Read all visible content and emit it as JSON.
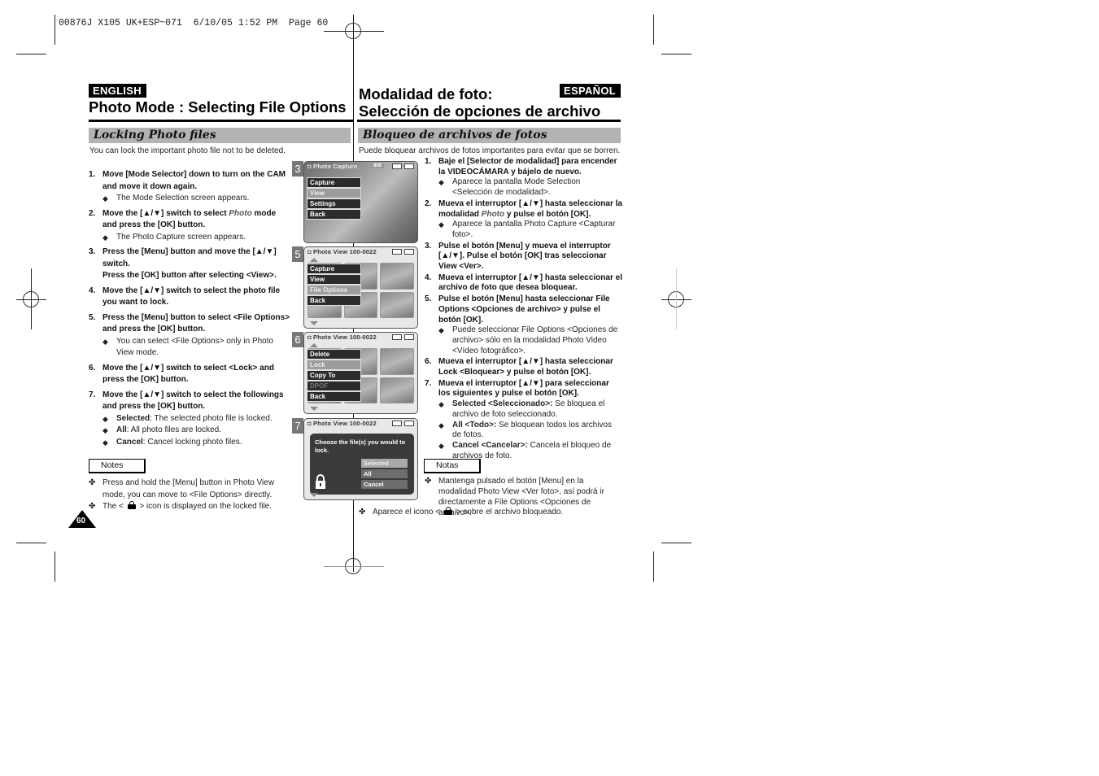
{
  "print_header": "00876J X105 UK+ESP~071  6/10/05 1:52 PM  Page 60",
  "page_number": "60",
  "english": {
    "lang_badge": "ENGLISH",
    "title": "Photo Mode : Selecting File Options",
    "section_title": "Locking Photo files",
    "intro": "You can lock the important photo file not to be deleted.",
    "steps": [
      {
        "num": "1.",
        "text": "Move [Mode Selector] down to turn on the CAM and move it down again.",
        "subs": [
          "The Mode Selection screen appears."
        ]
      },
      {
        "num": "2.",
        "text_before": "Move the [▲/▼] switch to select ",
        "text_em": "Photo",
        "text_after": " mode and press the [OK] button.",
        "subs": [
          "The Photo Capture screen appears."
        ]
      },
      {
        "num": "3.",
        "text": "Press the [Menu] button and move the [▲/▼] switch.",
        "text2": "Press the [OK] button after selecting <View>."
      },
      {
        "num": "4.",
        "text": "Move the [▲/▼] switch to select the photo file you want to lock."
      },
      {
        "num": "5.",
        "text": "Press the [Menu] button to select <File Options> and press the [OK] button.",
        "subs": [
          "You can select <File Options> only in Photo View mode."
        ]
      },
      {
        "num": "6.",
        "text": "Move the [▲/▼] switch to select <Lock> and press the [OK] button."
      },
      {
        "num": "7.",
        "text": "Move the [▲/▼] switch to select the followings and press the [OK] button.",
        "options": [
          {
            "term": "Selected",
            "desc": ": The selected photo file is locked."
          },
          {
            "term": "All",
            "desc": ": All photo files are locked."
          },
          {
            "term": "Cancel",
            "desc": ": Cancel locking photo files."
          }
        ]
      }
    ],
    "notes_label": "Notes",
    "notes": [
      "Press and hold the [Menu] button in Photo View mode, you can move to <File Options> directly."
    ],
    "note_lock_before": "The <",
    "note_lock_after": "> icon is displayed on the locked file."
  },
  "spanish": {
    "lang_badge": "ESPAÑOL",
    "title_line1": "Modalidad de foto:",
    "title_line2": "Selección de opciones de archivo",
    "section_title": "Bloqueo de archivos de fotos",
    "intro": "Puede bloquear archivos de fotos importantes para evitar que se borren.",
    "steps": [
      {
        "num": "1.",
        "text": "Baje el [Selector de modalidad] para encender la VIDEOCÁMARA y bájelo de nuevo.",
        "subs": [
          "Aparece la pantalla Mode Selection <Selección de modalidad>."
        ]
      },
      {
        "num": "2.",
        "text_before": "Mueva el interruptor [▲/▼] hasta seleccionar la modalidad ",
        "text_em": "Photo",
        "text_after": " y pulse el botón [OK].",
        "subs": [
          "Aparece la pantalla Photo Capture <Capturar foto>."
        ]
      },
      {
        "num": "3.",
        "text": "Pulse el botón [Menu] y mueva el interruptor [▲/▼]. Pulse el botón [OK] tras seleccionar View <Ver>."
      },
      {
        "num": "4.",
        "text": "Mueva el interruptor [▲/▼] hasta seleccionar el archivo de foto que desea bloquear."
      },
      {
        "num": "5.",
        "text": "Pulse el botón [Menu] hasta seleccionar File Options <Opciones de archivo> y pulse el botón [OK].",
        "subs": [
          "Puede seleccionar File Options <Opciones de archivo> sólo en la modalidad Photo Video <Vídeo fotográfico>."
        ]
      },
      {
        "num": "6.",
        "text": "Mueva el interruptor [▲/▼] hasta seleccionar Lock <Bloquear> y pulse el botón [OK]."
      },
      {
        "num": "7.",
        "text": "Mueva el interruptor [▲/▼] para seleccionar los siguientes y pulse el botón [OK].",
        "options": [
          {
            "term": "Selected <Seleccionado>:",
            "desc": " Se bloquea el archivo de foto seleccionado."
          },
          {
            "term": "All <Todo>:",
            "desc": " Se bloquean todos los archivos de fotos."
          },
          {
            "term": "Cancel <Cancelar>:",
            "desc": " Cancela el bloqueo de archivos de foto."
          }
        ]
      }
    ],
    "notes_label": "Notas",
    "notes": [
      "Mantenga pulsado el botón [Menu] en la modalidad Photo View <Ver foto>, así podrá ir directamente a File Options <Opciones de archivo>."
    ],
    "note_lock_before": "Aparece el icono <",
    "note_lock_after": "> sobre el archivo bloqueado."
  },
  "screens": [
    {
      "step": "3",
      "title": "Photo Capture",
      "badge": "800",
      "menu": [
        {
          "label": "Capture",
          "state": "normal"
        },
        {
          "label": "View",
          "state": "selected"
        },
        {
          "label": "Settings",
          "state": "normal"
        },
        {
          "label": "Back",
          "state": "normal"
        }
      ]
    },
    {
      "step": "5",
      "title": "Photo View 100-0022",
      "menu": [
        {
          "label": "Capture",
          "state": "normal"
        },
        {
          "label": "View",
          "state": "normal"
        },
        {
          "label": "File Options",
          "state": "selected"
        },
        {
          "label": "Back",
          "state": "normal"
        }
      ]
    },
    {
      "step": "6",
      "title": "Photo View 100-0022",
      "menu": [
        {
          "label": "Delete",
          "state": "normal"
        },
        {
          "label": "Lock",
          "state": "selected"
        },
        {
          "label": "Copy To",
          "state": "normal"
        },
        {
          "label": "DPOF",
          "state": "disabled"
        },
        {
          "label": "Back",
          "state": "normal"
        }
      ]
    },
    {
      "step": "7",
      "title": "Photo View 100-0022",
      "dialog_text": "Choose the file(s) you would to lock.",
      "options": [
        {
          "label": "Selected",
          "state": "selected"
        },
        {
          "label": "All",
          "state": "normal"
        },
        {
          "label": "Cancel",
          "state": "normal"
        }
      ]
    }
  ]
}
